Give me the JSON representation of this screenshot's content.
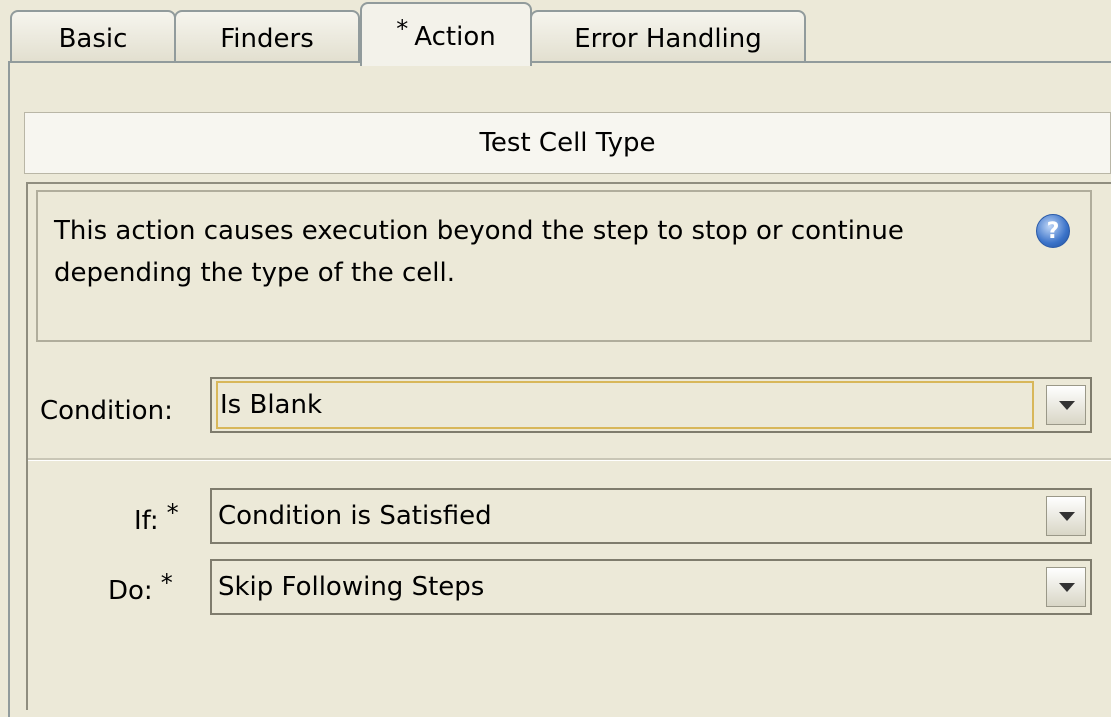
{
  "tabs": [
    {
      "label": "Basic"
    },
    {
      "label": "Finders"
    },
    {
      "label": "Action",
      "marker": "*"
    },
    {
      "label": "Error Handling"
    }
  ],
  "panel_title": "Test Cell Type",
  "description": "This action causes execution beyond the step to stop or continue depending the type of the cell.",
  "help_icon": "?",
  "condition": {
    "label": "Condition:",
    "value": "Is Blank"
  },
  "if_field": {
    "label": "If:",
    "required_marker": "*",
    "value": "Condition is Satisfied"
  },
  "do_field": {
    "label": "Do:",
    "required_marker": "*",
    "value": "Skip Following Steps"
  }
}
